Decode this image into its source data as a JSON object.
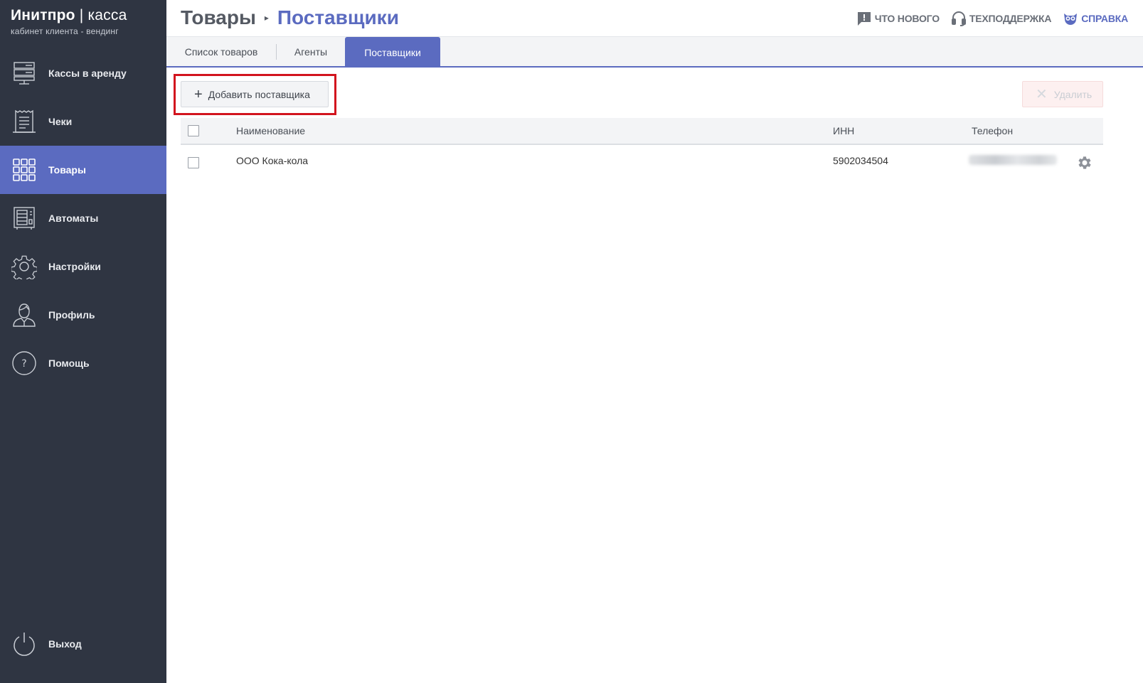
{
  "brand": {
    "name_bold": "Инитпро",
    "separator": " | ",
    "name_light": "касса",
    "subtitle": "кабинет клиента - вендинг"
  },
  "sidebar": {
    "items": [
      {
        "label": "Кассы в аренду",
        "icon": "server-icon",
        "active": false
      },
      {
        "label": "Чеки",
        "icon": "receipt-icon",
        "active": false
      },
      {
        "label": "Товары",
        "icon": "grid-icon",
        "active": true
      },
      {
        "label": "Автоматы",
        "icon": "vending-machine-icon",
        "active": false
      },
      {
        "label": "Настройки",
        "icon": "gear-icon",
        "active": false
      },
      {
        "label": "Профиль",
        "icon": "user-icon",
        "active": false
      },
      {
        "label": "Помощь",
        "icon": "question-icon",
        "active": false
      }
    ],
    "logout": {
      "label": "Выход",
      "icon": "power-icon"
    }
  },
  "header": {
    "breadcrumb_root": "Товары",
    "breadcrumb_sep": "▸",
    "breadcrumb_current": "Поставщики",
    "links": {
      "news": {
        "label": "ЧТО НОВОГО",
        "icon": "chat-alert-icon"
      },
      "support": {
        "label": "ТЕХПОДДЕРЖКА",
        "icon": "headset-icon"
      },
      "help": {
        "label": "СПРАВКА",
        "icon": "owl-icon"
      }
    }
  },
  "tabs": [
    "Список товаров",
    "Агенты",
    "Поставщики"
  ],
  "active_tab": "Поставщики",
  "toolbar": {
    "add_label": "Добавить поставщика",
    "delete_label": "Удалить"
  },
  "table": {
    "columns": [
      "Наименование",
      "ИНН",
      "Телефон"
    ],
    "rows": [
      {
        "name": "ООО Кока-кола",
        "inn": "5902034504",
        "phone": "",
        "checked": false
      }
    ]
  },
  "colors": {
    "sidebar_bg": "#2f3542",
    "accent": "#5b6bc0",
    "highlight": "#d2141e"
  }
}
